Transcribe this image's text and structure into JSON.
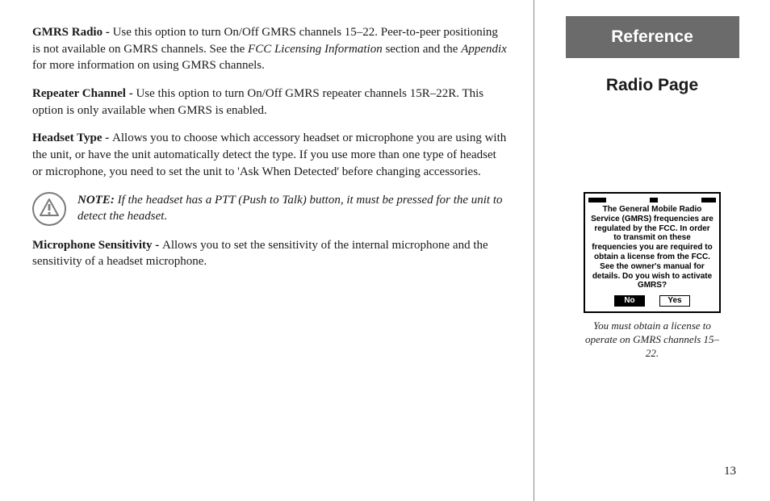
{
  "main": {
    "p1_label": "GMRS Radio - ",
    "p1_a": "Use this option to turn On/Off GMRS channels 15–22.  Peer-to-peer positioning is not available on GMRS channels.  See the ",
    "p1_i1": "FCC Licensing Information",
    "p1_b": " section and the ",
    "p1_i2": "Appendix",
    "p1_c": " for more information on using GMRS channels.",
    "p2_label": "Repeater Channel - ",
    "p2_a": "Use this option to turn On/Off GMRS repeater channels 15R–22R.  This option is only available when GMRS is enabled.",
    "p3_label": "Headset Type - ",
    "p3_a": "Allows you to choose which accessory headset or microphone you are using with the unit, or have the unit automatically detect the type.  If you use more than one type of headset or microphone, you need to set the unit to 'Ask When Detected' before changing accessories.",
    "note_label": "NOTE: ",
    "note_text": "If the headset has a PTT (Push to Talk) button, it must be pressed for the unit to detect the headset.",
    "p4_label": "Microphone Sensitivity - ",
    "p4_a": "Allows you to set the sensitivity of the internal microphone and the sensitivity of a headset microphone."
  },
  "sidebar": {
    "banner": "Reference",
    "subtitle": "Radio Page",
    "device_msg": "The General Mobile Radio Service (GMRS) frequencies are regulated by the FCC. In order to transmit on these frequencies you are required to obtain a license from the FCC. See the owner's manual for details. Do you wish to activate GMRS?",
    "btn_no": "No",
    "btn_yes": "Yes",
    "caption": "You must obtain a license to operate on GMRS channels 15–22."
  },
  "page_number": "13",
  "icons": {
    "warning": "warning-triangle"
  }
}
